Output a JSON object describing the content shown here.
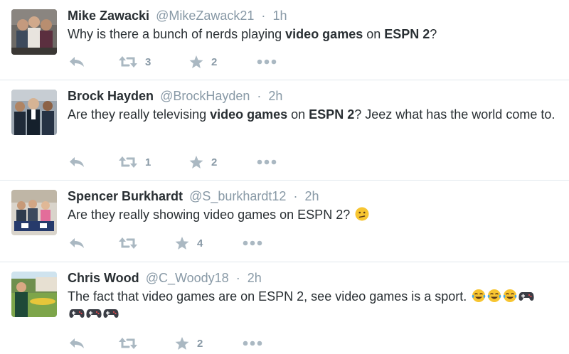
{
  "colors": {
    "name": "#292f33",
    "muted": "#8899a6",
    "icon": "#aab8c2",
    "divider": "#e1e8ed"
  },
  "tweets": [
    {
      "name": "Mike Zawacki",
      "handle": "@MikeZawack21",
      "separator": "·",
      "time": "1h",
      "text": [
        {
          "t": "Why is there a bunch of nerds playing "
        },
        {
          "t": "video games",
          "b": true
        },
        {
          "t": " on "
        },
        {
          "t": "ESPN 2",
          "b": true
        },
        {
          "t": "?"
        }
      ],
      "retweets": "3",
      "favorites": "2",
      "icons": [
        "reply-icon",
        "retweet-icon",
        "favorite-star-icon",
        "more-dots-icon"
      ]
    },
    {
      "name": "Brock Hayden",
      "handle": "@BrockHayden",
      "separator": "·",
      "time": "2h",
      "text": [
        {
          "t": "Are they really televising "
        },
        {
          "t": "video games",
          "b": true
        },
        {
          "t": " on "
        },
        {
          "t": "ESPN 2",
          "b": true
        },
        {
          "t": "? Jeez what has the world come to."
        }
      ],
      "retweets": "1",
      "favorites": "2",
      "icons": [
        "reply-icon",
        "retweet-icon",
        "favorite-star-icon",
        "more-dots-icon"
      ]
    },
    {
      "name": "Spencer Burkhardt",
      "handle": "@S_burkhardt12",
      "separator": "·",
      "time": "2h",
      "text": [
        {
          "t": "Are they really showing video games on ESPN 2? "
        }
      ],
      "emojis": [
        "confused-face-emoji"
      ],
      "retweets": "",
      "favorites": "4",
      "icons": [
        "reply-icon",
        "retweet-icon",
        "favorite-star-icon",
        "more-dots-icon"
      ]
    },
    {
      "name": "Chris Wood",
      "handle": "@C_Woody18",
      "separator": "·",
      "time": "2h",
      "text": [
        {
          "t": "The fact that video games are on ESPN 2, see video games is a sport. "
        }
      ],
      "emojis": [
        "tears-of-joy-emoji",
        "tears-of-joy-emoji",
        "tears-of-joy-emoji",
        "game-controller-emoji",
        "game-controller-emoji",
        "game-controller-emoji",
        "game-controller-emoji"
      ],
      "retweets": "",
      "favorites": "2",
      "icons": [
        "reply-icon",
        "retweet-icon",
        "favorite-star-icon",
        "more-dots-icon"
      ]
    }
  ]
}
